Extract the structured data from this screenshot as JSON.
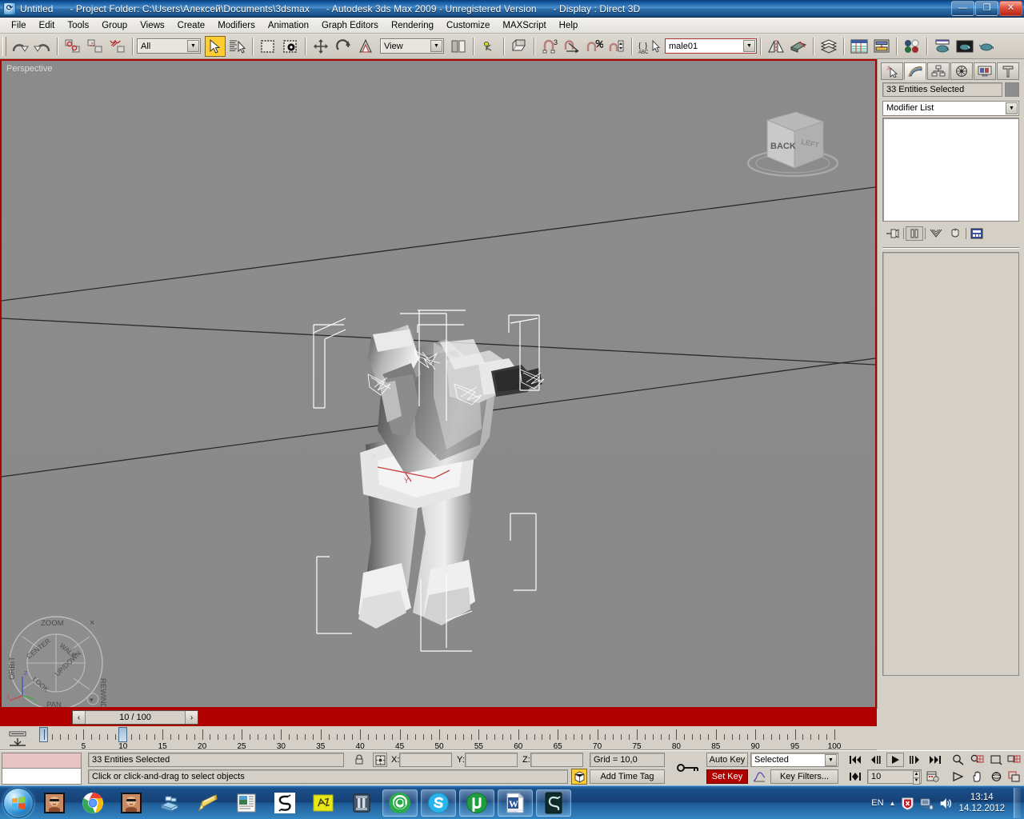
{
  "window": {
    "app_icon": "max-logo-icon",
    "title_file": "Untitled",
    "title_project": "- Project Folder: C:\\Users\\Алексей\\Documents\\3dsmax",
    "title_app": "- Autodesk 3ds Max  2009  - Unregistered Version",
    "title_display": "- Display : Direct 3D",
    "minimize": "—",
    "maximize": "❐",
    "close": "✕"
  },
  "menu": {
    "items": [
      {
        "label": "File",
        "name": "menu-file"
      },
      {
        "label": "Edit",
        "name": "menu-edit"
      },
      {
        "label": "Tools",
        "name": "menu-tools"
      },
      {
        "label": "Group",
        "name": "menu-group"
      },
      {
        "label": "Views",
        "name": "menu-views"
      },
      {
        "label": "Create",
        "name": "menu-create"
      },
      {
        "label": "Modifiers",
        "name": "menu-modifiers"
      },
      {
        "label": "Animation",
        "name": "menu-animation"
      },
      {
        "label": "Graph Editors",
        "name": "menu-graph-editors"
      },
      {
        "label": "Rendering",
        "name": "menu-rendering"
      },
      {
        "label": "Customize",
        "name": "menu-customize"
      },
      {
        "label": "MAXScript",
        "name": "menu-maxscript"
      },
      {
        "label": "Help",
        "name": "menu-help"
      }
    ]
  },
  "toolbar": {
    "selection_filter": "All",
    "reference_coord": "View",
    "named_selection": "male01",
    "buttons": [
      "undo-icon",
      "redo-icon",
      "select-and-link-icon",
      "unlink-selection-icon",
      "bind-to-space-warp-icon",
      "select-object-icon",
      "select-by-name-icon",
      "rectangular-selection-region-icon",
      "window-crossing-icon",
      "select-and-move-icon",
      "select-and-rotate-icon",
      "select-and-scale-icon",
      "use-center-flyout-icon",
      "select-and-manipulate-icon",
      "snaps-toggle-3d-icon",
      "angle-snap-toggle-icon",
      "percent-snap-toggle-icon",
      "spinner-snap-toggle-icon",
      "edit-named-selection-sets-icon",
      "mirror-icon",
      "align-icon",
      "layer-manager-icon",
      "curve-editor-icon",
      "schematic-view-icon",
      "material-editor-icon",
      "render-setup-icon",
      "rendered-frame-window-icon",
      "render-production-icon"
    ]
  },
  "viewport": {
    "label": "Perspective",
    "viewcube": {
      "face_back": "BACK",
      "face_left": "LEFT"
    },
    "steeringwheel": {
      "zoom": "ZOOM",
      "orbit": "ORBIT",
      "pan": "PAN",
      "rewind": "REWIND",
      "center": "CENTER",
      "walk": "WALK",
      "look": "LOOK",
      "up_down": "UP/DOWN",
      "close": "×",
      "menu": "▾"
    },
    "axis_x": "X",
    "axis_y": "Y",
    "axis_z": "Z"
  },
  "command_panel": {
    "tabs": [
      {
        "name": "cp-tab-create",
        "icon": "create-star-icon"
      },
      {
        "name": "cp-tab-modify",
        "icon": "modify-curve-icon"
      },
      {
        "name": "cp-tab-hierarchy",
        "icon": "hierarchy-icon"
      },
      {
        "name": "cp-tab-motion",
        "icon": "motion-wheel-icon"
      },
      {
        "name": "cp-tab-display",
        "icon": "display-monitor-icon"
      },
      {
        "name": "cp-tab-utilities",
        "icon": "utilities-hammer-icon"
      }
    ],
    "selected_tab_index": 1,
    "object_name": "33 Entities Selected",
    "modifier_list": "Modifier List",
    "stack_tools": [
      "pin-stack-icon",
      "show-end-result-icon",
      "make-unique-icon",
      "remove-modifier-icon",
      "configure-modifier-sets-icon"
    ]
  },
  "timeline": {
    "current_frame_label": "10 / 100",
    "prev_arrow": "‹",
    "next_arrow": "›",
    "range_start": 0,
    "range_end": 100,
    "current_frame": 10,
    "tick_labels": [
      5,
      10,
      15,
      20,
      25,
      30,
      35,
      40,
      45,
      50,
      55,
      60,
      65,
      70,
      75,
      80,
      85,
      90,
      95,
      100
    ]
  },
  "statusbar": {
    "selection_status": "33 Entities Selected",
    "prompt": "Click or click-and-drag to select objects",
    "lock_icon": "lock-selection-icon",
    "absolute_mode_icon": "absolute-relative-transform-icon",
    "x_label": "X:",
    "x_value": "",
    "y_label": "Y:",
    "y_value": "",
    "z_label": "Z:",
    "z_value": "",
    "grid_label": "Grid = 10,0",
    "add_time_tag": "Add Time Tag",
    "key_mode_icon": "key-mode-toggle-icon",
    "auto_key": "Auto Key",
    "set_key": "Set Key",
    "key_filter_set": "Selected",
    "key_filters": "Key Filters...",
    "curve_icon": "parameter-curve-icon",
    "playback": {
      "go_to_start": "goto-start-icon",
      "prev_frame": "previous-frame-icon",
      "play": "play-animation-icon",
      "next_frame": "next-frame-icon",
      "go_to_end": "goto-end-icon",
      "key_mode": "key-mode-icon",
      "current_frame_value": "10",
      "time_config": "time-configuration-icon"
    },
    "nav_tools": [
      "zoom-icon",
      "zoom-all-icon",
      "zoom-extents-icon",
      "zoom-extents-all-icon",
      "field-of-view-icon",
      "pan-view-icon",
      "arc-rotate-icon",
      "maximize-viewport-toggle-icon"
    ]
  },
  "taskbar": {
    "start_icon": "windows-start-orb-icon",
    "items": [
      {
        "name": "taskbar-item-media1",
        "icon": "thumbnail-photo-icon",
        "framed": false
      },
      {
        "name": "taskbar-item-chrome",
        "icon": "chrome-icon",
        "framed": false
      },
      {
        "name": "taskbar-item-media2",
        "icon": "thumbnail-photo-icon",
        "framed": false
      },
      {
        "name": "taskbar-item-installer",
        "icon": "blue-boxes-icon",
        "framed": false
      },
      {
        "name": "taskbar-item-notepad",
        "icon": "yellow-pencil-icon",
        "framed": false
      },
      {
        "name": "taskbar-item-reader",
        "icon": "document-window-icon",
        "framed": false
      },
      {
        "name": "taskbar-item-sublime",
        "icon": "s-swirl-icon",
        "framed": false
      },
      {
        "name": "taskbar-item-yellow",
        "icon": "yellow-note-icon",
        "framed": false
      },
      {
        "name": "taskbar-item-gateway",
        "icon": "pillar-icon",
        "framed": false
      },
      {
        "name": "taskbar-item-mail",
        "icon": "at-sign-green-icon",
        "framed": true
      },
      {
        "name": "taskbar-item-skype",
        "icon": "skype-icon",
        "framed": true
      },
      {
        "name": "taskbar-item-utorrent",
        "icon": "utorrent-icon",
        "framed": true
      },
      {
        "name": "taskbar-item-word",
        "icon": "word-icon",
        "framed": true
      },
      {
        "name": "taskbar-item-3dsmax",
        "icon": "max-logo-icon",
        "framed": true
      }
    ],
    "tray": {
      "language": "EN",
      "expand": "▲",
      "kaspersky_icon": "kaspersky-shield-icon",
      "network_icon": "network-icon",
      "volume_icon": "volume-icon",
      "time": "13:14",
      "date": "14.12.2012"
    }
  }
}
